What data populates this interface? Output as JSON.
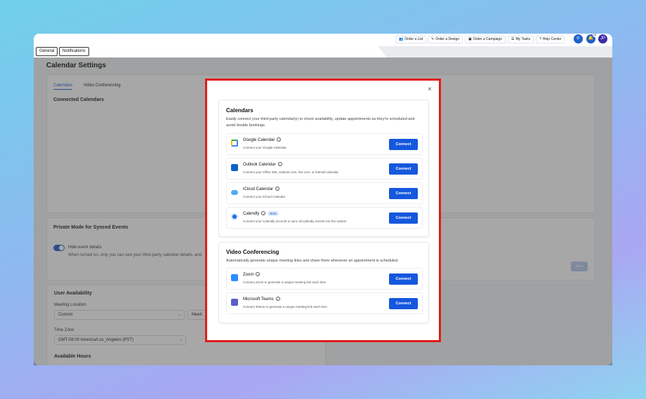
{
  "topbar": {
    "quick_actions": [
      {
        "icon": "users-icon",
        "glyph": "👥",
        "label": "Order a List"
      },
      {
        "icon": "brush-icon",
        "glyph": "✎",
        "label": "Order a Design"
      },
      {
        "icon": "campaign-icon",
        "glyph": "▣",
        "label": "Order a Campaign"
      },
      {
        "icon": "tasks-icon",
        "glyph": "☰",
        "label": "My Tasks"
      },
      {
        "icon": "help-icon",
        "glyph": "?",
        "label": "Help Center"
      }
    ],
    "notification_count": "10",
    "avatar_initials": "JP",
    "tabs": [
      "General",
      "Notifications"
    ]
  },
  "page": {
    "title": "Calendar Settings",
    "sub_tabs": [
      "Calendars",
      "Video Conferencing"
    ],
    "connected_calendars_label": "Connected Calendars",
    "private_mode_label": "Private Mode for Synced Events",
    "hide_event_details_label": "Hide event details",
    "hide_event_details_desc": "When turned on, only you can see your third-party calendar details, and",
    "save_label": "Save",
    "user_availability_label": "User Availability",
    "meeting_location_label": "Meeting Location",
    "meeting_location_value": "Custom",
    "meeting_location_partial": "Meeti",
    "time_zone_label": "Time Zone",
    "time_zone_value": "GMT-08:00 America/Los_Angeles (PST)",
    "available_hours_label": "Available Hours"
  },
  "modal": {
    "close_glyph": "×",
    "calendars": {
      "title": "Calendars",
      "description": "Easily connect your third-party calendar(s) to check availability, update appointments as they're scheduled and avoid double bookings.",
      "items": [
        {
          "name": "Google Calendar",
          "desc": "Connect your Google Calendar",
          "button": "Connect",
          "badge": ""
        },
        {
          "name": "Outlook Calendar",
          "desc": "Connect your Office 365, Outlook.com, live.com, or hotmail calendar",
          "button": "Connect",
          "badge": ""
        },
        {
          "name": "iCloud Calendar",
          "desc": "Connect your iCloud Calendar",
          "button": "Connect",
          "badge": ""
        },
        {
          "name": "Calendly",
          "desc": "Connect your Calendly account to sync all calendly events into the system",
          "button": "Connect",
          "badge": "Beta"
        }
      ]
    },
    "video": {
      "title": "Video Conferencing",
      "description": "Automatically generate unique meeting links and share them whenever an appointment is scheduled.",
      "items": [
        {
          "name": "Zoom",
          "desc": "Connect Zoom to generate a unique meeting link each time",
          "button": "Connect"
        },
        {
          "name": "Microsoft Teams",
          "desc": "Connect Teams to generate a unique meeting link each time",
          "button": "Connect"
        }
      ]
    }
  },
  "colors": {
    "accent": "#1557dd",
    "highlight_border": "#e01b1b",
    "toggle_on": "#1f5fcc"
  }
}
